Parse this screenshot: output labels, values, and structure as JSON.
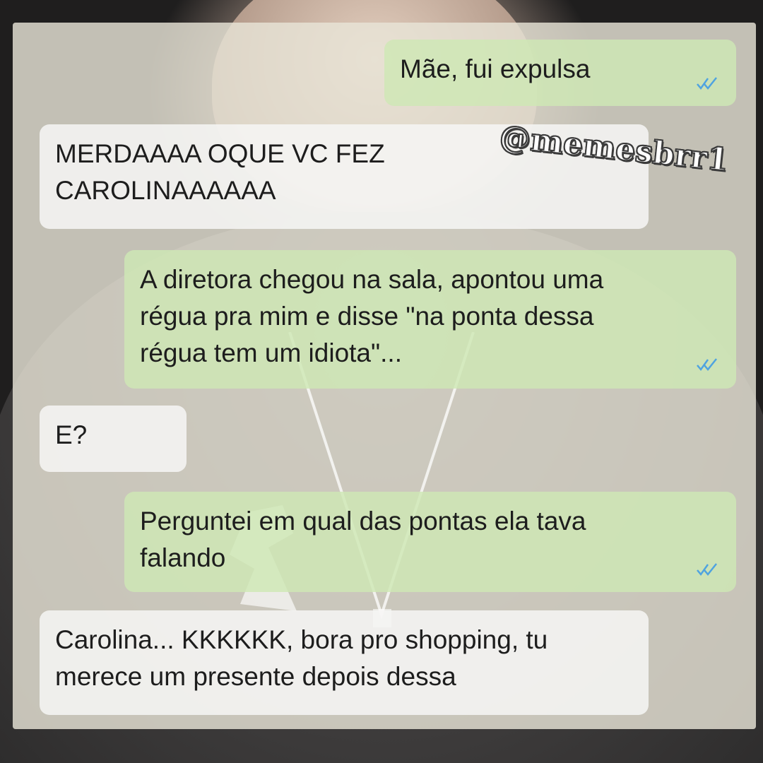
{
  "watermark": "@memesbrr1",
  "messages": [
    {
      "side": "out",
      "text": "Mãe, fui expulsa",
      "read": true
    },
    {
      "side": "in",
      "text": "MERDAAAA OQUE VC FEZ\nCAROLINAAAAAA"
    },
    {
      "side": "out",
      "text": "A diretora chegou na sala, apontou uma\nrégua pra mim e disse \"na ponta dessa\nrégua tem um idiota\"...",
      "read": true
    },
    {
      "side": "in",
      "text": "E?"
    },
    {
      "side": "out",
      "text": "Perguntei em qual das pontas ela tava\nfalando",
      "read": true
    },
    {
      "side": "in",
      "text": "Carolina... KKKKKK, bora pro shopping, tu\nmerece um presente depois dessa"
    }
  ],
  "icons": {
    "read_receipt": "double-check-icon"
  },
  "colors": {
    "outgoing_bubble": "#cee8b4",
    "incoming_bubble": "#f6f6f4",
    "read_tick": "#4fa3e0",
    "text": "#1d1d1d"
  }
}
